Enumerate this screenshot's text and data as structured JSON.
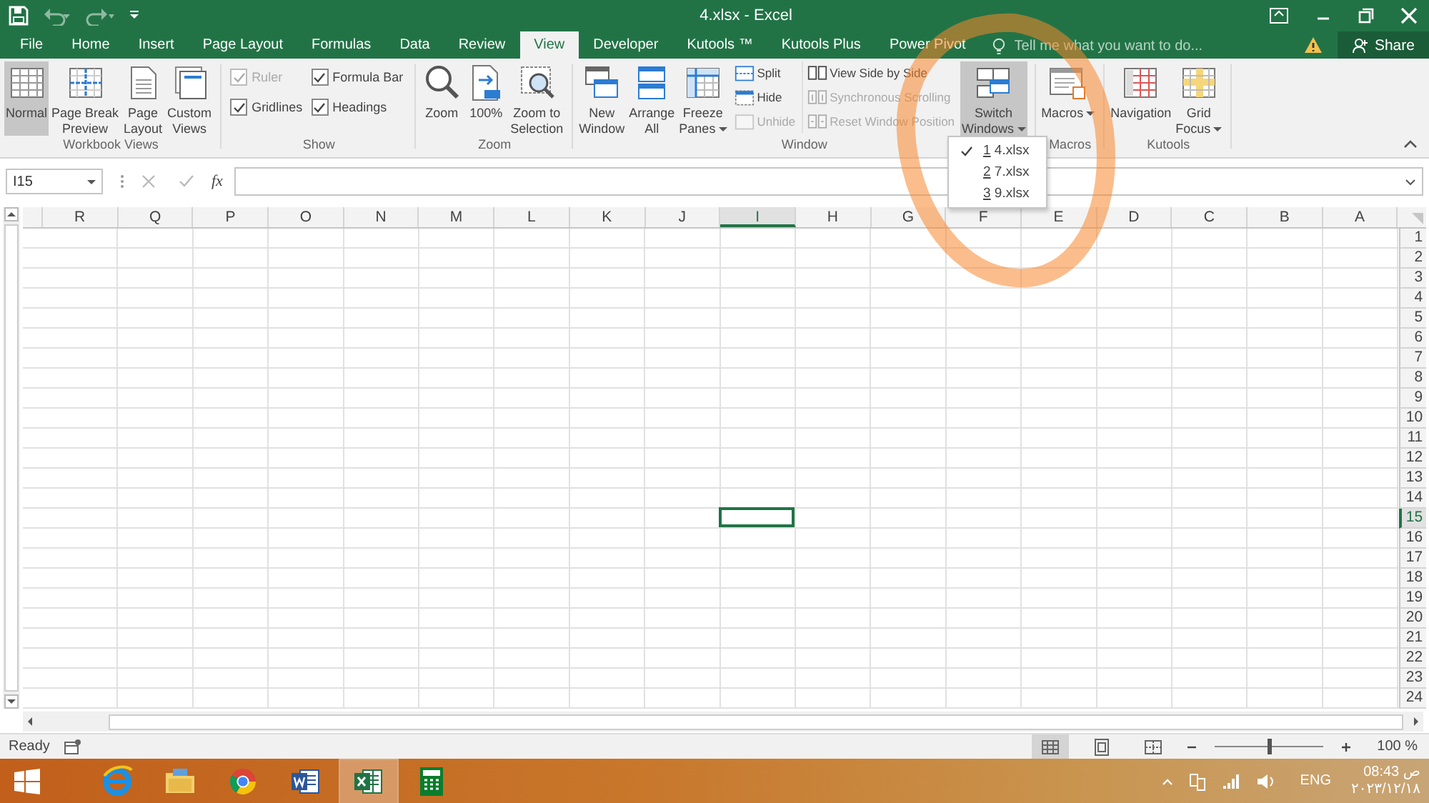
{
  "window": {
    "title": "4.xlsx - Excel"
  },
  "tabs": [
    {
      "label": "File",
      "selected": false
    },
    {
      "label": "Home",
      "selected": false
    },
    {
      "label": "Insert",
      "selected": false
    },
    {
      "label": "Page Layout",
      "selected": false
    },
    {
      "label": "Formulas",
      "selected": false
    },
    {
      "label": "Data",
      "selected": false
    },
    {
      "label": "Review",
      "selected": false
    },
    {
      "label": "View",
      "selected": true
    },
    {
      "label": "Developer",
      "selected": false
    },
    {
      "label": "Kutools ™",
      "selected": false
    },
    {
      "label": "Kutools Plus",
      "selected": false
    },
    {
      "label": "Power Pivot",
      "selected": false
    }
  ],
  "tell_me": {
    "placeholder": "Tell me what you want to do..."
  },
  "share": "Share",
  "ribbon_groups": [
    {
      "label": "Workbook Views",
      "items": [
        {
          "kind": "large",
          "label": "Normal",
          "selected": true,
          "dropdown": false
        },
        {
          "kind": "large",
          "label": "Page Break\nPreview",
          "selected": false,
          "dropdown": false
        },
        {
          "kind": "large",
          "label": "Page\nLayout",
          "selected": false,
          "dropdown": false
        },
        {
          "kind": "large",
          "label": "Custom\nViews",
          "selected": false,
          "dropdown": false
        }
      ]
    },
    {
      "label": "Show",
      "items": [
        {
          "kind": "check",
          "label": "Ruler",
          "checked": true,
          "disabled": true
        },
        {
          "kind": "check",
          "label": "Formula Bar",
          "checked": true,
          "disabled": false
        },
        {
          "kind": "check",
          "label": "Gridlines",
          "checked": true,
          "disabled": false
        },
        {
          "kind": "check",
          "label": "Headings",
          "checked": true,
          "disabled": false
        }
      ]
    },
    {
      "label": "Zoom",
      "items": [
        {
          "kind": "large",
          "label": "Zoom",
          "selected": false,
          "dropdown": false
        },
        {
          "kind": "large",
          "label": "100%",
          "selected": false,
          "dropdown": false
        },
        {
          "kind": "large",
          "label": "Zoom to\nSelection",
          "selected": false,
          "dropdown": false
        }
      ]
    },
    {
      "label": "Window",
      "items": [
        {
          "kind": "large",
          "label": "New\nWindow",
          "selected": false,
          "dropdown": false
        },
        {
          "kind": "large",
          "label": "Arrange\nAll",
          "selected": false,
          "dropdown": false
        },
        {
          "kind": "large",
          "label": "Freeze\nPanes",
          "selected": false,
          "dropdown": true
        },
        {
          "kind": "small",
          "label": "Split",
          "disabled": false
        },
        {
          "kind": "small",
          "label": "Hide",
          "disabled": false
        },
        {
          "kind": "small",
          "label": "Unhide",
          "disabled": true
        },
        {
          "kind": "small",
          "label": "View Side by Side",
          "disabled": false
        },
        {
          "kind": "small",
          "label": "Synchronous Scrolling",
          "disabled": true
        },
        {
          "kind": "small",
          "label": "Reset Window Position",
          "disabled": true
        },
        {
          "kind": "large",
          "label": "Switch\nWindows",
          "selected": true,
          "dropdown": true
        }
      ]
    },
    {
      "label": "Macros",
      "items": [
        {
          "kind": "large",
          "label": "Macros",
          "selected": false,
          "dropdown": true
        }
      ]
    },
    {
      "label": "Kutools",
      "items": [
        {
          "kind": "large",
          "label": "Navigation",
          "selected": false,
          "dropdown": false
        },
        {
          "kind": "large",
          "label": "Grid\nFocus",
          "selected": false,
          "dropdown": true
        }
      ]
    }
  ],
  "switch_windows_menu": [
    {
      "key": "1",
      "label": "4.xlsx",
      "checked": true
    },
    {
      "key": "2",
      "label": "7.xlsx",
      "checked": false
    },
    {
      "key": "3",
      "label": "9.xlsx",
      "checked": false
    }
  ],
  "name_box": "I15",
  "insert_function": "fx",
  "columns": [
    {
      "label": "R",
      "selected": false
    },
    {
      "label": "Q",
      "selected": false
    },
    {
      "label": "P",
      "selected": false
    },
    {
      "label": "O",
      "selected": false
    },
    {
      "label": "N",
      "selected": false
    },
    {
      "label": "M",
      "selected": false
    },
    {
      "label": "L",
      "selected": false
    },
    {
      "label": "K",
      "selected": false
    },
    {
      "label": "J",
      "selected": false
    },
    {
      "label": "I",
      "selected": true
    },
    {
      "label": "H",
      "selected": false
    },
    {
      "label": "G",
      "selected": false
    },
    {
      "label": "F",
      "selected": false
    },
    {
      "label": "E",
      "selected": false
    },
    {
      "label": "D",
      "selected": false
    },
    {
      "label": "C",
      "selected": false
    },
    {
      "label": "B",
      "selected": false
    },
    {
      "label": "A",
      "selected": false
    }
  ],
  "rows": [
    {
      "label": "1",
      "selected": false
    },
    {
      "label": "2",
      "selected": false
    },
    {
      "label": "3",
      "selected": false
    },
    {
      "label": "4",
      "selected": false
    },
    {
      "label": "5",
      "selected": false
    },
    {
      "label": "6",
      "selected": false
    },
    {
      "label": "7",
      "selected": false
    },
    {
      "label": "8",
      "selected": false
    },
    {
      "label": "9",
      "selected": false
    },
    {
      "label": "10",
      "selected": false
    },
    {
      "label": "11",
      "selected": false
    },
    {
      "label": "12",
      "selected": false
    },
    {
      "label": "13",
      "selected": false
    },
    {
      "label": "14",
      "selected": false
    },
    {
      "label": "15",
      "selected": true
    },
    {
      "label": "16",
      "selected": false
    },
    {
      "label": "17",
      "selected": false
    },
    {
      "label": "18",
      "selected": false
    },
    {
      "label": "19",
      "selected": false
    },
    {
      "label": "20",
      "selected": false
    },
    {
      "label": "21",
      "selected": false
    },
    {
      "label": "22",
      "selected": false
    },
    {
      "label": "23",
      "selected": false
    },
    {
      "label": "24",
      "selected": false
    }
  ],
  "status_bar": {
    "status": "Ready",
    "views": [
      {
        "selected": true
      },
      {
        "selected": false
      },
      {
        "selected": false
      }
    ],
    "zoom": {
      "level": 0.5,
      "reading": "100 %"
    }
  },
  "taskbar": {
    "apps": [
      {
        "selected": false
      },
      {
        "selected": false
      },
      {
        "selected": false
      },
      {
        "selected": false
      },
      {
        "selected": true
      },
      {
        "selected": false
      }
    ],
    "language": "ENG",
    "time": "08:43 ص",
    "date": "٢٠٢٣/١٢/١٨"
  },
  "annotations": [
    {
      "kind": "freehand-circle"
    }
  ]
}
